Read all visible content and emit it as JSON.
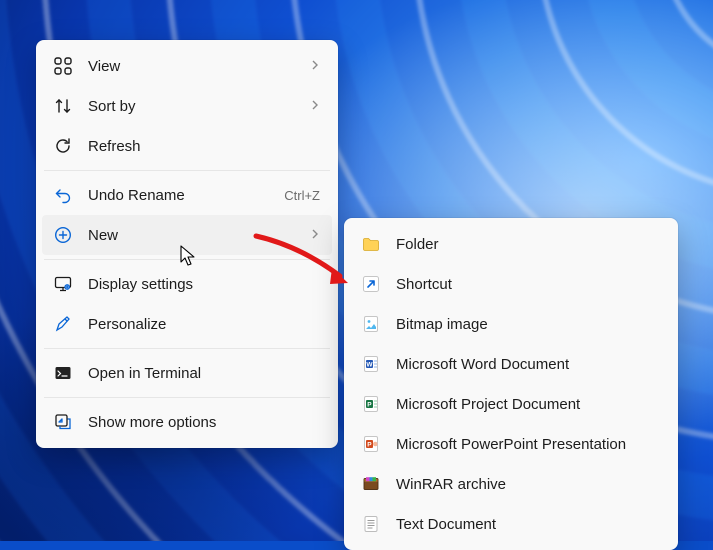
{
  "contextMenu": {
    "view": {
      "label": "View",
      "hasSubmenu": true
    },
    "sortBy": {
      "label": "Sort by",
      "hasSubmenu": true
    },
    "refresh": {
      "label": "Refresh"
    },
    "undoRename": {
      "label": "Undo Rename",
      "shortcut": "Ctrl+Z"
    },
    "new": {
      "label": "New",
      "hasSubmenu": true,
      "highlighted": true
    },
    "displaySettings": {
      "label": "Display settings"
    },
    "personalize": {
      "label": "Personalize"
    },
    "openInTerminal": {
      "label": "Open in Terminal"
    },
    "showMoreOptions": {
      "label": "Show more options"
    }
  },
  "newSubmenu": {
    "folder": {
      "label": "Folder"
    },
    "shortcut": {
      "label": "Shortcut"
    },
    "bitmap": {
      "label": "Bitmap image"
    },
    "word": {
      "label": "Microsoft Word Document"
    },
    "project": {
      "label": "Microsoft Project Document"
    },
    "powerpoint": {
      "label": "Microsoft PowerPoint Presentation"
    },
    "winrar": {
      "label": "WinRAR archive"
    },
    "text": {
      "label": "Text Document"
    }
  },
  "annotation": {
    "arrowTarget": "shortcut"
  }
}
